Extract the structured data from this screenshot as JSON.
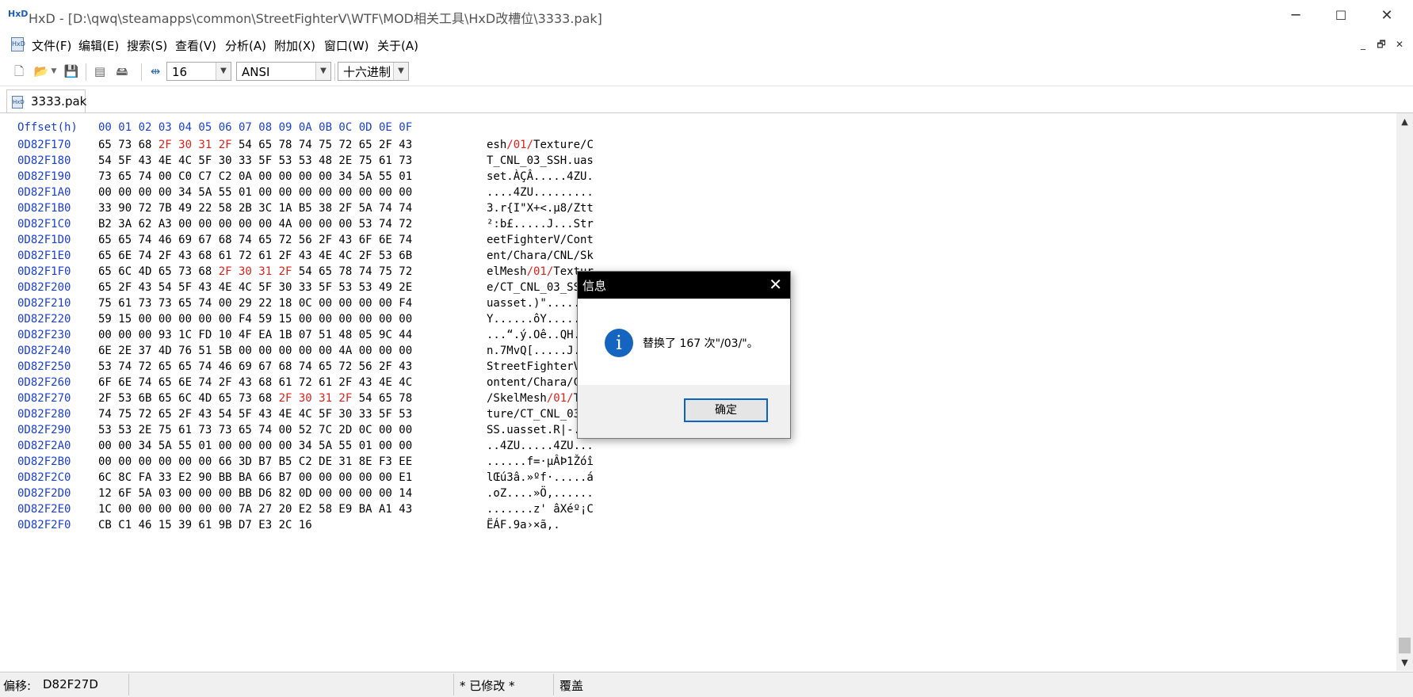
{
  "window": {
    "app_icon": "HxD",
    "title": "HxD - [D:\\qwq\\steamapps\\common\\StreetFighterV\\WTF\\MOD相关工具\\HxD改槽位\\3333.pak]",
    "minimize": "─",
    "maximize": "☐",
    "close": "✕"
  },
  "menu": {
    "items": [
      "文件(F)",
      "编辑(E)",
      "搜索(S)",
      "查看(V)",
      "分析(A)",
      "附加(X)",
      "窗口(W)",
      "关于(A)"
    ],
    "mdi_buttons": [
      "_",
      "🗗",
      "✕"
    ]
  },
  "toolbar": {
    "icons": [
      "new-file-icon",
      "open-file-icon",
      "save-icon",
      "ram-icon",
      "disk-icon",
      "column-width-icon"
    ],
    "bytes_per_row": "16",
    "charset": "ANSI",
    "offset_base": "十六进制"
  },
  "tabs": [
    {
      "label": "3333.pak"
    }
  ],
  "hex": {
    "header_offset": "Offset(h)",
    "header_cols": "00 01 02 03 04 05 06 07 08 09 0A 0B 0C 0D 0E 0F",
    "rows": [
      {
        "off": "0D82F170",
        "bytes": [
          [
            "65 73 68 ",
            0
          ],
          [
            "2F 30 31 2F",
            1
          ],
          [
            " 54 65 78 74 75 72 65 2F 43",
            0
          ]
        ],
        "ascii": [
          [
            "esh",
            0
          ],
          [
            "/01/",
            1
          ],
          [
            "Texture/C",
            0
          ]
        ]
      },
      {
        "off": "0D82F180",
        "bytes": [
          [
            "54 5F 43 4E 4C 5F 30 33 5F 53 53 48 2E 75 61 73",
            0
          ]
        ],
        "ascii": [
          [
            "T_CNL_03_SSH.uas",
            0
          ]
        ]
      },
      {
        "off": "0D82F190",
        "bytes": [
          [
            "73 65 74 00 C0 C7 C2 0A 00 00 00 00 34 5A 55 01",
            0
          ]
        ],
        "ascii": [
          [
            "set.ÀÇÂ.....4ZU.",
            0
          ]
        ]
      },
      {
        "off": "0D82F1A0",
        "bytes": [
          [
            "00 00 00 00 34 5A 55 01 00 00 00 00 00 00 00 00",
            0
          ]
        ],
        "ascii": [
          [
            "....4ZU.........",
            0
          ]
        ]
      },
      {
        "off": "0D82F1B0",
        "bytes": [
          [
            "33 90 72 7B 49 22 58 2B 3C 1A B5 38 2F 5A 74 74",
            0
          ]
        ],
        "ascii": [
          [
            "3.r{I\"X+<.µ8/Ztt",
            0
          ]
        ]
      },
      {
        "off": "0D82F1C0",
        "bytes": [
          [
            "B2 3A 62 A3 00 00 00 00 00 4A 00 00 00 53 74 72",
            0
          ]
        ],
        "ascii": [
          [
            "²:b£.....J...Str",
            0
          ]
        ]
      },
      {
        "off": "0D82F1D0",
        "bytes": [
          [
            "65 65 74 46 69 67 68 74 65 72 56 2F 43 6F 6E 74",
            0
          ]
        ],
        "ascii": [
          [
            "eetFighterV/Cont",
            0
          ]
        ]
      },
      {
        "off": "0D82F1E0",
        "bytes": [
          [
            "65 6E 74 2F 43 68 61 72 61 2F 43 4E 4C 2F 53 6B",
            0
          ]
        ],
        "ascii": [
          [
            "ent/Chara/CNL/Sk",
            0
          ]
        ]
      },
      {
        "off": "0D82F1F0",
        "bytes": [
          [
            "65 6C 4D 65 73 68 ",
            0
          ],
          [
            "2F 30 31 2F",
            1
          ],
          [
            " 54 65 78 74 75 72",
            0
          ]
        ],
        "ascii": [
          [
            "elMesh",
            0
          ],
          [
            "/01/",
            1
          ],
          [
            "Textur",
            0
          ]
        ]
      },
      {
        "off": "0D82F200",
        "bytes": [
          [
            "65 2F 43 54 5F 43 4E 4C 5F 30 33 5F 53 53 49 2E",
            0
          ]
        ],
        "ascii": [
          [
            "e/CT_CNL_03_SSI.",
            0
          ]
        ]
      },
      {
        "off": "0D82F210",
        "bytes": [
          [
            "75 61 73 73 65 74 00 29 22 18 0C 00 00 00 00 F4",
            0
          ]
        ],
        "ascii": [
          [
            "uasset.)\"......ô",
            0
          ]
        ]
      },
      {
        "off": "0D82F220",
        "bytes": [
          [
            "59 15 00 00 00 00 00 F4 59 15 00 00 00 00 00 00",
            0
          ]
        ],
        "ascii": [
          [
            "Y......ôY.......",
            0
          ]
        ]
      },
      {
        "off": "0D82F230",
        "bytes": [
          [
            "00 00 00 93 1C FD 10 4F EA 1B 07 51 48 05 9C 44",
            0
          ]
        ],
        "ascii": [
          [
            "...“.ý.Oê..QH.œD",
            0
          ]
        ]
      },
      {
        "off": "0D82F240",
        "bytes": [
          [
            "6E 2E 37 4D 76 51 5B 00 00 00 00 00 4A 00 00 00",
            0
          ]
        ],
        "ascii": [
          [
            "n.7MvQ[.....J...",
            0
          ]
        ]
      },
      {
        "off": "0D82F250",
        "bytes": [
          [
            "53 74 72 65 65 74 46 69 67 68 74 65 72 56 2F 43",
            0
          ]
        ],
        "ascii": [
          [
            "StreetFighterV/C",
            0
          ]
        ]
      },
      {
        "off": "0D82F260",
        "bytes": [
          [
            "6F 6E 74 65 6E 74 2F 43 68 61 72 61 2F 43 4E 4C",
            0
          ]
        ],
        "ascii": [
          [
            "ontent/Chara/CNL",
            0
          ]
        ]
      },
      {
        "off": "0D82F270",
        "bytes": [
          [
            "2F 53 6B 65 6C 4D 65 73 68 ",
            0
          ],
          [
            "2F 30 31 2F",
            1
          ],
          [
            " 54 65 78",
            0
          ]
        ],
        "ascii": [
          [
            "/SkelMesh",
            0
          ],
          [
            "/01/",
            1
          ],
          [
            "Tex",
            0
          ]
        ]
      },
      {
        "off": "0D82F280",
        "bytes": [
          [
            "74 75 72 65 2F 43 54 5F 43 4E 4C 5F 30 33 5F 53",
            0
          ]
        ],
        "ascii": [
          [
            "ture/CT_CNL_03_S",
            0
          ]
        ]
      },
      {
        "off": "0D82F290",
        "bytes": [
          [
            "53 53 2E 75 61 73 73 65 74 00 52 7C 2D 0C 00 00",
            0
          ]
        ],
        "ascii": [
          [
            "SS.uasset.R|-...",
            0
          ]
        ]
      },
      {
        "off": "0D82F2A0",
        "bytes": [
          [
            "00 00 34 5A 55 01 00 00 00 00 34 5A 55 01 00 00",
            0
          ]
        ],
        "ascii": [
          [
            "..4ZU.....4ZU...",
            0
          ]
        ]
      },
      {
        "off": "0D82F2B0",
        "bytes": [
          [
            "00 00 00 00 00 00 66 3D B7 B5 C2 DE 31 8E F3 EE",
            0
          ]
        ],
        "ascii": [
          [
            "......f=·µÂÞ1Žóî",
            0
          ]
        ]
      },
      {
        "off": "0D82F2C0",
        "bytes": [
          [
            "6C 8C FA 33 E2 90 BB BA 66 B7 00 00 00 00 00 E1",
            0
          ]
        ],
        "ascii": [
          [
            "lŒú3â.»ºf·.....á",
            0
          ]
        ]
      },
      {
        "off": "0D82F2D0",
        "bytes": [
          [
            "12 6F 5A 03 00 00 00 BB D6 82 0D 00 00 00 00 14",
            0
          ]
        ],
        "ascii": [
          [
            ".oZ....»Ö‚......",
            0
          ]
        ]
      },
      {
        "off": "0D82F2E0",
        "bytes": [
          [
            "1C 00 00 00 00 00 00 7A 27 20 E2 58 E9 BA A1 43",
            0
          ]
        ],
        "ascii": [
          [
            ".......z' âXéº¡C",
            0
          ]
        ]
      },
      {
        "off": "0D82F2F0",
        "bytes": [
          [
            "CB C1 46 15 39 61 9B D7 E3 2C 16",
            0
          ]
        ],
        "ascii": [
          [
            "ËÁF.9a›×ã,.",
            0
          ]
        ]
      }
    ]
  },
  "status": {
    "offset_label": "偏移:",
    "offset_value": "D82F27D",
    "modified": "* 已修改 *",
    "mode": "覆盖"
  },
  "dialog": {
    "title": "信息",
    "close": "✕",
    "icon": "i",
    "message": "替换了 167 次\"/03/\"。",
    "ok_label": "确定"
  }
}
